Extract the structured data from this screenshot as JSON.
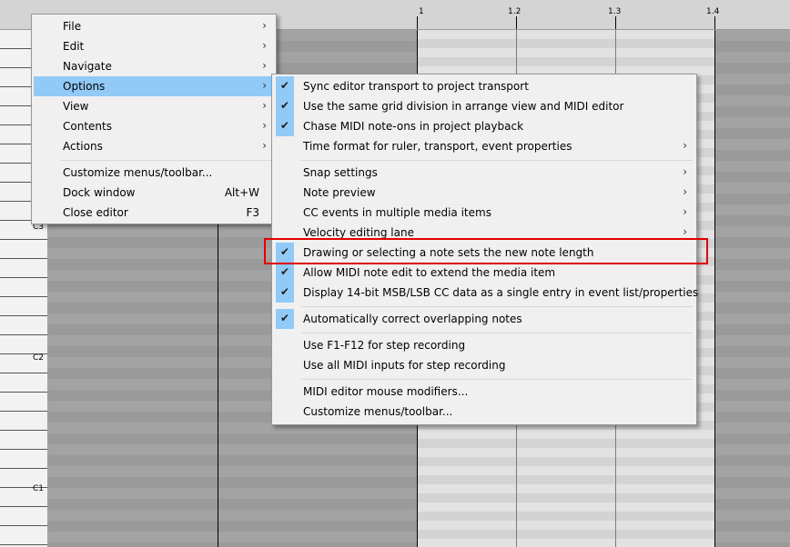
{
  "ruler": {
    "ticks": [
      "1",
      "1.2",
      "1.3",
      "1.4"
    ]
  },
  "piano": {
    "labels": [
      "C3",
      "C2",
      "C1"
    ]
  },
  "main_menu": {
    "items": [
      {
        "label": "File",
        "submenu": true
      },
      {
        "label": "Edit",
        "submenu": true
      },
      {
        "label": "Navigate",
        "submenu": true
      },
      {
        "label": "Options",
        "submenu": true,
        "highlighted": true
      },
      {
        "label": "View",
        "submenu": true
      },
      {
        "label": "Contents",
        "submenu": true
      },
      {
        "label": "Actions",
        "submenu": true
      },
      {
        "label": "Customize menus/toolbar..."
      },
      {
        "label": "Dock window",
        "shortcut": "Alt+W"
      },
      {
        "label": "Close editor",
        "shortcut": "F3"
      }
    ]
  },
  "options_menu": {
    "items": [
      {
        "label": "Sync editor transport to project transport",
        "checked": true
      },
      {
        "label": "Use the same grid division in arrange view and MIDI editor",
        "checked": true
      },
      {
        "label": "Chase MIDI note-ons in project playback",
        "checked": true
      },
      {
        "label": "Time format for ruler, transport, event properties",
        "submenu": true
      },
      {
        "label": "Snap settings",
        "submenu": true
      },
      {
        "label": "Note preview",
        "submenu": true
      },
      {
        "label": "CC events in multiple media items",
        "submenu": true
      },
      {
        "label": "Velocity editing lane",
        "submenu": true
      },
      {
        "label": "Drawing or selecting a note sets the new note length",
        "checked": true
      },
      {
        "label": "Allow MIDI note edit to extend the media item",
        "checked": true
      },
      {
        "label": "Display 14-bit MSB/LSB CC data as a single entry in event list/properties",
        "checked": true
      },
      {
        "label": "Automatically correct overlapping notes",
        "checked": true
      },
      {
        "label": "Use F1-F12 for step recording"
      },
      {
        "label": "Use all MIDI inputs for step recording"
      },
      {
        "label": "MIDI editor mouse modifiers..."
      },
      {
        "label": "Customize menus/toolbar..."
      }
    ]
  },
  "icons": {
    "check": "✔",
    "arrow": "›"
  },
  "colors": {
    "menu_highlight": "#91c9f7",
    "annotation": "#e00000"
  }
}
